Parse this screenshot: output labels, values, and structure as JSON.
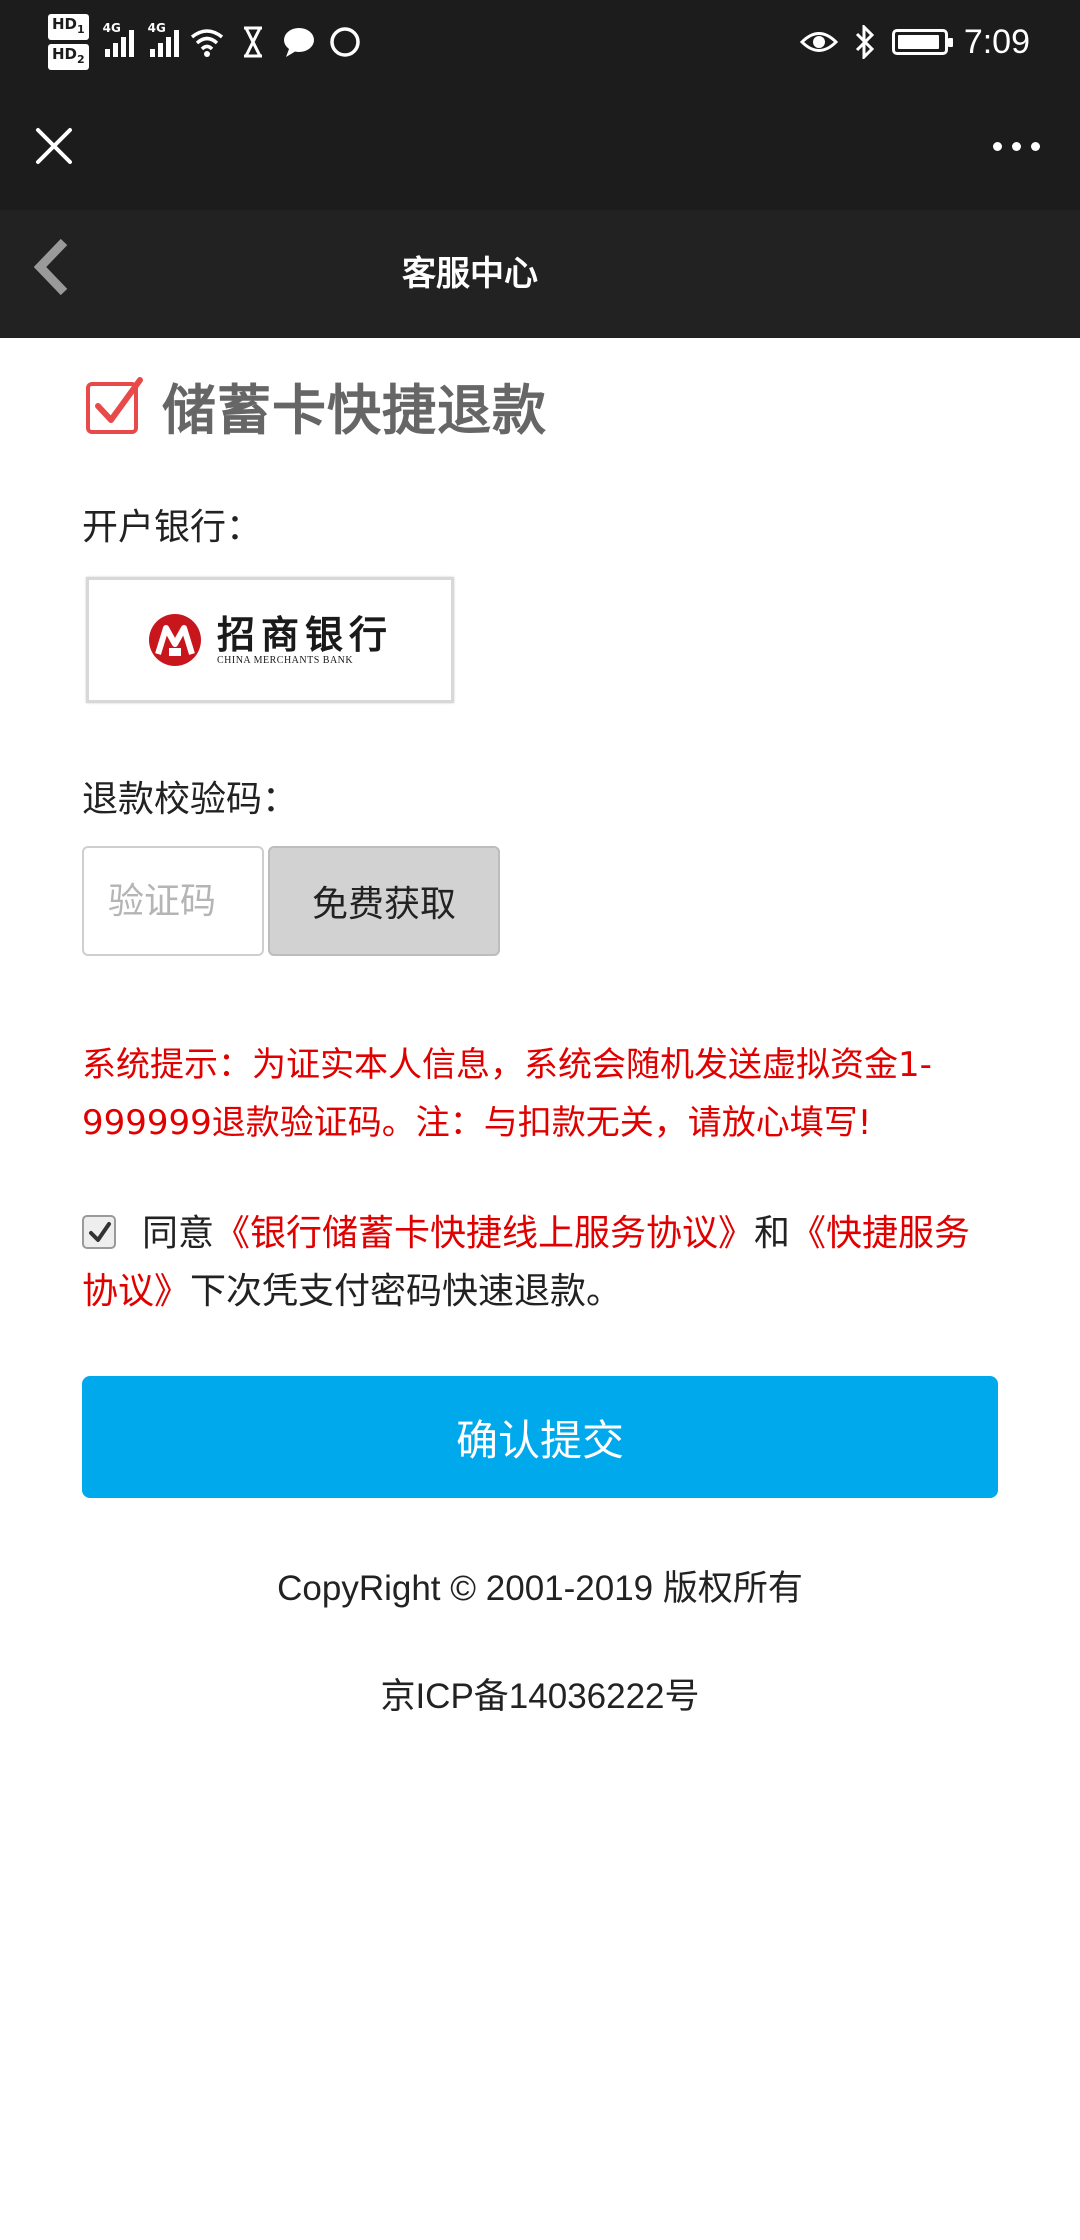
{
  "status_bar": {
    "hd1": "HD",
    "hd1_sub": "1",
    "hd2": "HD",
    "hd2_sub": "2",
    "signal1_tag": "4G",
    "signal2_tag": "4G",
    "time": "7:09",
    "battery_level": 0.95,
    "icons": [
      "wifi-icon",
      "hourglass-icon",
      "chat-bubble-icon",
      "loading-circle-icon",
      "eye-icon",
      "bluetooth-icon",
      "battery-icon"
    ]
  },
  "top_bar": {
    "close_icon": "close-icon",
    "more_icon": "more-dots-icon"
  },
  "header": {
    "title": "客服中心",
    "back_icon": "chevron-left-icon"
  },
  "section": {
    "title": "储蓄卡快捷退款",
    "icon": "checkbox-checked-icon"
  },
  "bank": {
    "label": "开户银行：",
    "name_cn": "招商银行",
    "name_en": "CHINA MERCHANTS BANK",
    "logo_color": "#c8161d"
  },
  "verify": {
    "label": "退款校验码：",
    "input_placeholder": "验证码",
    "input_value": "",
    "get_code_label": "免费获取"
  },
  "notice": "系统提示：为证实本人信息，系统会随机发送虚拟资金1-999999退款验证码。注：与扣款无关，请放心填写!",
  "agreement": {
    "checked": true,
    "prefix": "同意",
    "link1": "《银行储蓄卡快捷线上服务协议》",
    "middle": "和",
    "link2": "《快捷服务协议》",
    "suffix": "下次凭支付密码快速退款。"
  },
  "submit_label": "确认提交",
  "footer": {
    "copyright": "CopyRight © 2001-2019 版权所有",
    "icp": "京ICP备14036222号"
  },
  "colors": {
    "accent_blue": "#00a8ec",
    "warning_red": "#e00000",
    "header_bg": "#222222",
    "statusbar_bg": "#1c1c1c"
  }
}
